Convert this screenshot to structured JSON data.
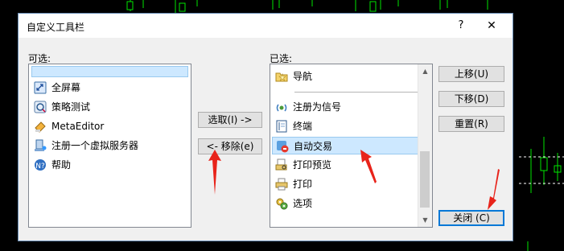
{
  "dialog": {
    "title": "自定义工具栏",
    "help_label": "?",
    "close_label": "✕"
  },
  "available": {
    "label": "可选:",
    "items": [
      {
        "label": "",
        "icon": "separator"
      },
      {
        "label": "全屏幕",
        "icon": "fullscreen-icon"
      },
      {
        "label": "策略测试",
        "icon": "strategy-tester-icon"
      },
      {
        "label": "MetaEditor",
        "icon": "metaeditor-icon"
      },
      {
        "label": "注册一个虚拟服务器",
        "icon": "virtual-server-icon"
      },
      {
        "label": "帮助",
        "icon": "help-icon"
      }
    ]
  },
  "selected": {
    "label": "已选:",
    "items": [
      {
        "label": "导航",
        "icon": "navigator-icon"
      },
      {
        "label": "",
        "icon": "separator"
      },
      {
        "label": "注册为信号",
        "icon": "signal-icon"
      },
      {
        "label": "终端",
        "icon": "terminal-icon"
      },
      {
        "label": "自动交易",
        "icon": "autotrading-icon"
      },
      {
        "label": "打印预览",
        "icon": "print-preview-icon"
      },
      {
        "label": "打印",
        "icon": "print-icon"
      },
      {
        "label": "选项",
        "icon": "options-icon"
      }
    ]
  },
  "buttons": {
    "add": "选取(I) ->",
    "remove": "<- 移除(e)",
    "move_up": "上移(U)",
    "move_down": "下移(D)",
    "reset": "重置(R)",
    "close": "关闭 (C)"
  },
  "colors": {
    "selection": "#cde8ff",
    "annotation_arrow": "#e8231a",
    "chart_green": "#00e400"
  }
}
